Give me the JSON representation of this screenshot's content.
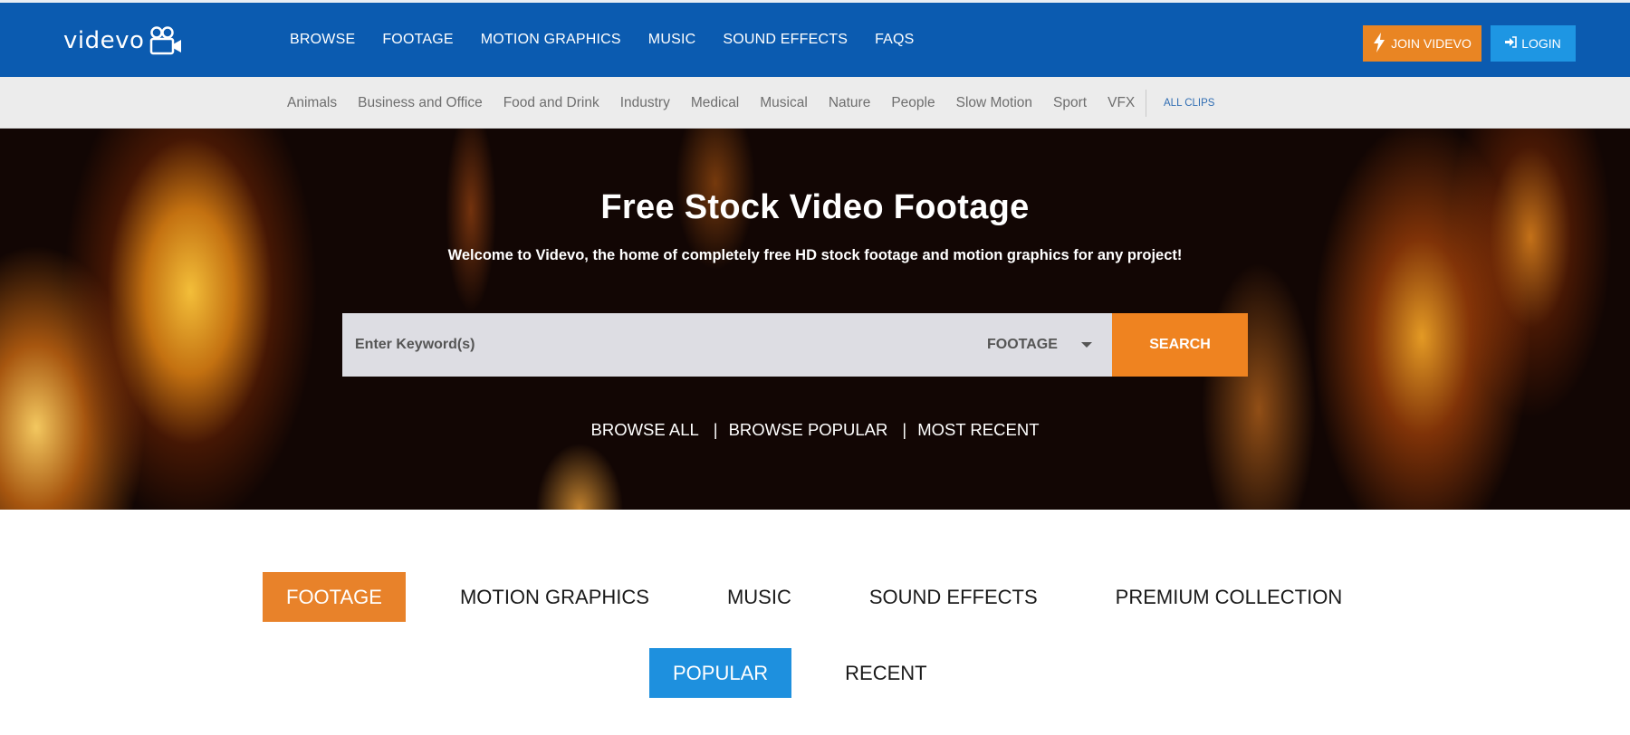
{
  "header": {
    "logo_text": "videvo",
    "nav": [
      "BROWSE",
      "FOOTAGE",
      "MOTION GRAPHICS",
      "MUSIC",
      "SOUND EFFECTS",
      "FAQS"
    ],
    "join_label": "JOIN VIDEVO",
    "login_label": "LOGIN"
  },
  "categories": {
    "items": [
      "Animals",
      "Business and Office",
      "Food and Drink",
      "Industry",
      "Medical",
      "Musical",
      "Nature",
      "People",
      "Slow Motion",
      "Sport",
      "VFX"
    ],
    "all_clips": "ALL CLIPS"
  },
  "hero": {
    "title": "Free Stock Video Footage",
    "subtitle": "Welcome to Videvo, the home of completely free HD stock footage and motion graphics for any project!",
    "search": {
      "placeholder": "Enter Keyword(s)",
      "type_selected": "FOOTAGE",
      "button": "SEARCH"
    },
    "links": [
      "BROWSE ALL",
      "BROWSE POPULAR",
      "MOST RECENT"
    ],
    "separator": "|"
  },
  "content_tabs": {
    "items": [
      "FOOTAGE",
      "MOTION GRAPHICS",
      "MUSIC",
      "SOUND EFFECTS",
      "PREMIUM COLLECTION"
    ],
    "active": "FOOTAGE"
  },
  "sort_tabs": {
    "items": [
      "POPULAR",
      "RECENT"
    ],
    "active": "POPULAR"
  },
  "colors": {
    "header_bg": "#0b5bb0",
    "join_button": "#e98523",
    "login_button": "#1e96e3",
    "search_button": "#ef8320",
    "active_tab": "#e8822a",
    "active_subtab": "#1e90de"
  }
}
